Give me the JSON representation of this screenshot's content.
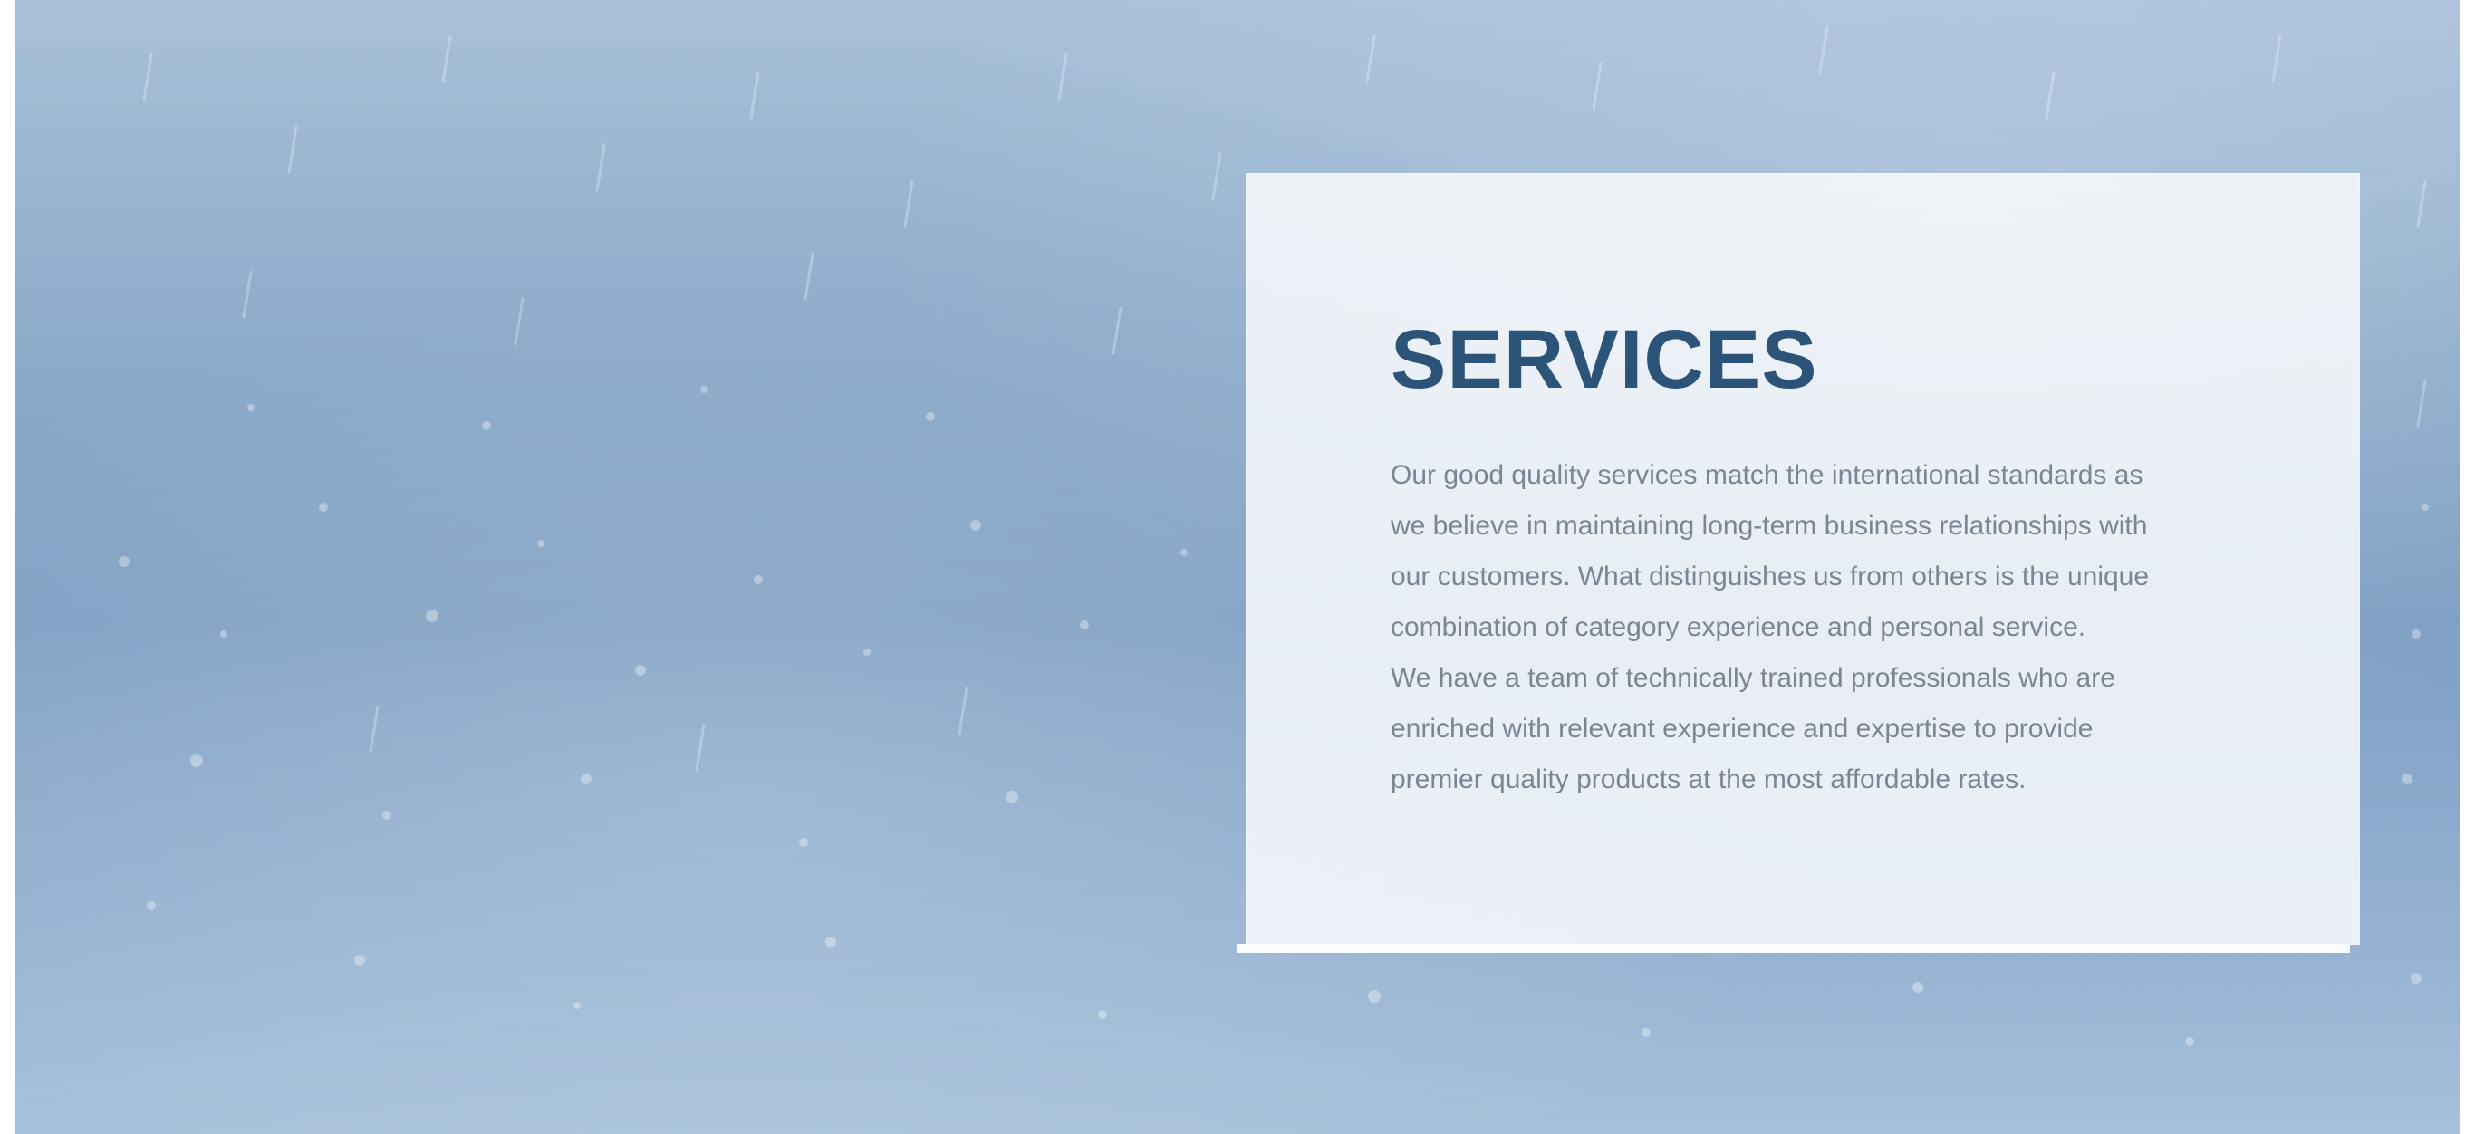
{
  "services": {
    "title": "SERVICES",
    "paragraph_1": "Our good quality services match the international standards as\nwe believe in maintaining long-term business relationships with\nour customers. What distinguishes us from others is the unique\ncombination of category experience and personal service.",
    "paragraph_2": "We have a team of technically trained professionals who are\nenriched with relevant experience and expertise to provide\npremier quality products at the most affordable rates."
  },
  "colors": {
    "title": "#2c5378",
    "body_text": "#7a8793",
    "card_background": "#f8fafc",
    "backdrop": "#89a8c8"
  }
}
